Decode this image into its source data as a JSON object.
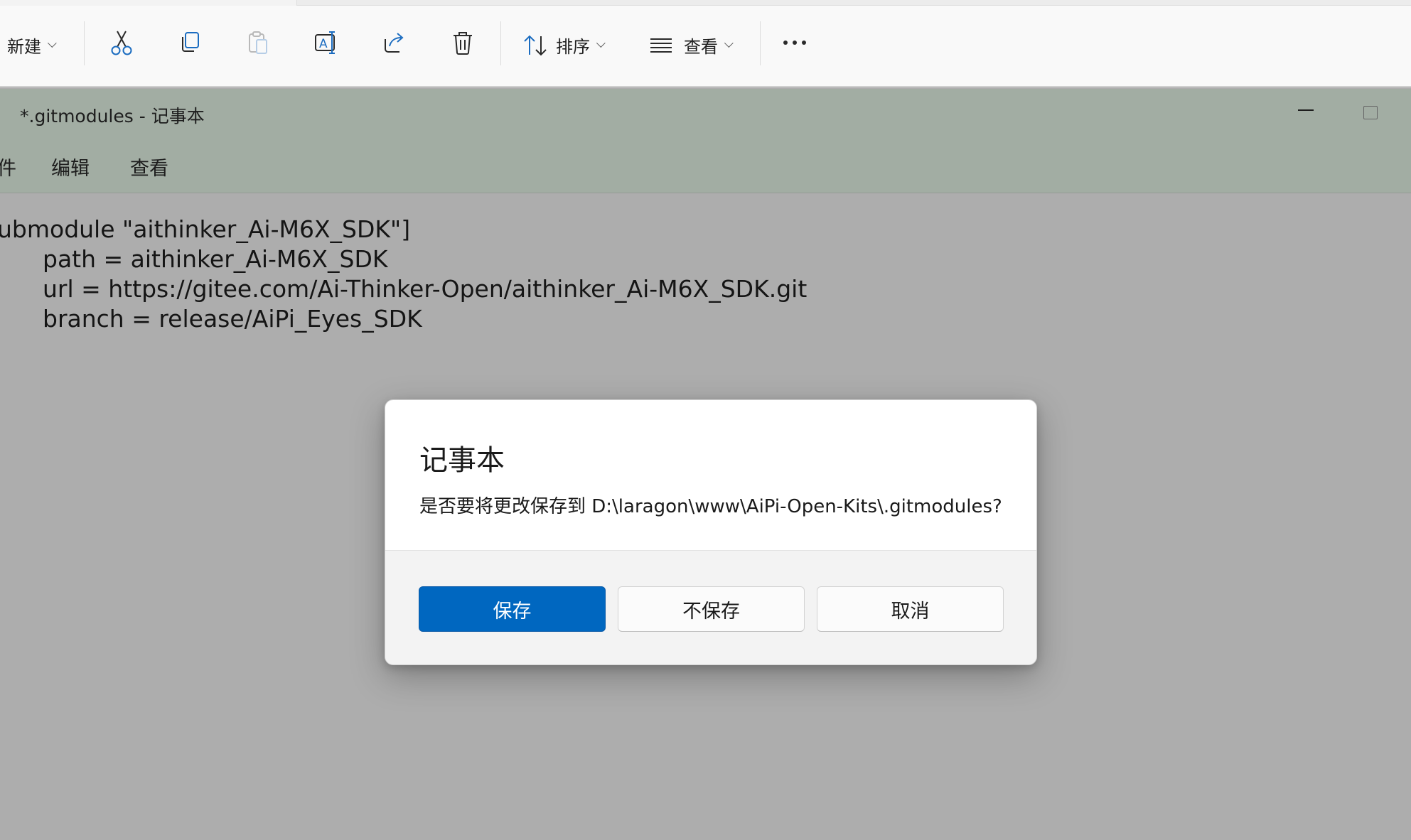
{
  "explorer_toolbar": {
    "new_label": "新建",
    "sort_label": "排序",
    "view_label": "查看",
    "icons": [
      "cut-icon",
      "copy-icon",
      "paste-icon",
      "rename-icon",
      "share-icon",
      "delete-icon",
      "sort-icon",
      "view-icon",
      "more-icon"
    ]
  },
  "notepad": {
    "window_title": "*.gitmodules - 记事本",
    "menu": [
      "件",
      "编辑",
      "查看"
    ],
    "lines": [
      "ubmodule \"aithinker_Ai-M6X_SDK\"]",
      "path = aithinker_Ai-M6X_SDK",
      "url = https://gitee.com/Ai-Thinker-Open/aithinker_Ai-M6X_SDK.git",
      "branch = release/AiPi_Eyes_SDK"
    ]
  },
  "dialog": {
    "title": "记事本",
    "message": "是否要将更改保存到 D:\\laragon\\www\\AiPi-Open-Kits\\.gitmodules?",
    "buttons": {
      "save": "保存",
      "dont_save": "不保存",
      "cancel": "取消"
    }
  },
  "colors": {
    "primary_button": "#0067c0",
    "dim_overlay": "#adadad",
    "titlebar_dim": "#a2ada3"
  }
}
